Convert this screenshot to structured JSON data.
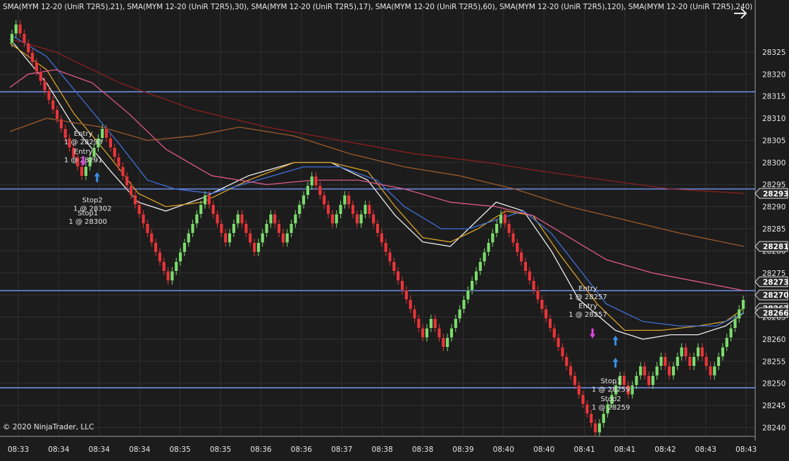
{
  "header": {
    "indicator_title": "SMA(MYM 12-20 (UniR T2R5),21), SMA(MYM 12-20 (UniR T2R5),30), SMA(MYM 12-20 (UniR T2R5),17), SMA(MYM 12-20 (UniR T2R5),60), SMA(MYM 12-20 (UniR T2R5),120), SMA(MYM 12-20 (UniR T2R5),240)"
  },
  "footer": {
    "copyright": "© 2020 NinjaTrader, LLC"
  },
  "icons": {
    "nav": "arrow-right-icon"
  },
  "colors": {
    "background": "#1c1c1c",
    "grid": "#2f2f2f",
    "up_bar": "#7ddc6e",
    "down_bar": "#e8363a",
    "hline": "#6f8fe6",
    "sma_white": "#ececec",
    "sma_gold": "#d9a12a",
    "sma_blue": "#3f6fd9",
    "sma_pink": "#e0598a",
    "sma_brown": "#9c5a2c",
    "sma_darkred": "#8c1f1f"
  },
  "chart_data": {
    "type": "candlestick",
    "title": "",
    "instrument": "MYM 12-20",
    "bar_type": "UniR T2R5",
    "ylim": [
      28238,
      28332
    ],
    "y_ticks": [
      28325,
      28320,
      28315,
      28310,
      28305,
      28300,
      28295,
      28290,
      28285,
      28280,
      28275,
      28270,
      28265,
      28260,
      28255,
      28250,
      28245,
      28240
    ],
    "x_ticks": [
      "08:33",
      "08:34",
      "08:34",
      "08:34",
      "08:35",
      "08:35",
      "08:36",
      "08:36",
      "08:37",
      "08:38",
      "08:38",
      "08:39",
      "08:40",
      "08:40",
      "08:41",
      "08:41",
      "08:42",
      "08:43",
      "08:43"
    ],
    "grid": true,
    "horizontal_lines": [
      28316,
      28294,
      28271,
      28249
    ],
    "price_markers": [
      {
        "value": 28293,
        "label": "28293"
      },
      {
        "value": 28281,
        "label": "28281"
      },
      {
        "value": 28273,
        "label": "28273"
      },
      {
        "value": 28270,
        "label": "28270"
      },
      {
        "value": 28267,
        "label": "28267"
      },
      {
        "value": 28266,
        "label": "28266"
      }
    ],
    "renko_moves": [
      {
        "dir": 1,
        "n": 2
      },
      {
        "dir": -1,
        "n": 16
      },
      {
        "dir": 1,
        "n": 5
      },
      {
        "dir": -1,
        "n": 16
      },
      {
        "dir": 1,
        "n": 9
      },
      {
        "dir": -1,
        "n": 5
      },
      {
        "dir": 1,
        "n": 3
      },
      {
        "dir": -1,
        "n": 4
      },
      {
        "dir": 1,
        "n": 4
      },
      {
        "dir": -1,
        "n": 3
      },
      {
        "dir": 1,
        "n": 7
      },
      {
        "dir": -1,
        "n": 5
      },
      {
        "dir": 1,
        "n": 3
      },
      {
        "dir": -1,
        "n": 3
      },
      {
        "dir": 1,
        "n": 2
      },
      {
        "dir": -1,
        "n": 14
      },
      {
        "dir": 1,
        "n": 2
      },
      {
        "dir": -1,
        "n": 3
      },
      {
        "dir": 1,
        "n": 14
      },
      {
        "dir": -1,
        "n": 23
      },
      {
        "dir": 1,
        "n": 6
      },
      {
        "dir": -1,
        "n": 2
      },
      {
        "dir": 1,
        "n": 3
      },
      {
        "dir": -1,
        "n": 2
      },
      {
        "dir": 1,
        "n": 3
      },
      {
        "dir": -1,
        "n": 2
      },
      {
        "dir": 1,
        "n": 3
      },
      {
        "dir": -1,
        "n": 2
      },
      {
        "dir": 1,
        "n": 2
      },
      {
        "dir": -1,
        "n": 3
      },
      {
        "dir": 1,
        "n": 8
      }
    ],
    "series": [
      {
        "name": "SMA 17",
        "color": "#ececec",
        "values": [
          [
            0,
            28328
          ],
          [
            8,
            28318
          ],
          [
            14,
            28308
          ],
          [
            22,
            28298
          ],
          [
            28,
            28291
          ],
          [
            34,
            28289
          ],
          [
            42,
            28292
          ],
          [
            52,
            28297
          ],
          [
            62,
            28300
          ],
          [
            70,
            28300
          ],
          [
            78,
            28296
          ],
          [
            84,
            28288
          ],
          [
            90,
            28282
          ],
          [
            96,
            28281
          ],
          [
            102,
            28287
          ],
          [
            106,
            28291
          ],
          [
            112,
            28289
          ],
          [
            118,
            28280
          ],
          [
            124,
            28269
          ],
          [
            132,
            28262
          ],
          [
            138,
            28260
          ],
          [
            144,
            28261
          ],
          [
            150,
            28261
          ],
          [
            156,
            28263
          ],
          [
            160,
            28266
          ]
        ]
      },
      {
        "name": "SMA 21",
        "color": "#d9a12a",
        "values": [
          [
            0,
            28327
          ],
          [
            8,
            28321
          ],
          [
            14,
            28311
          ],
          [
            22,
            28301
          ],
          [
            28,
            28293
          ],
          [
            34,
            28290
          ],
          [
            42,
            28291
          ],
          [
            52,
            28296
          ],
          [
            62,
            28300
          ],
          [
            70,
            28300
          ],
          [
            78,
            28298
          ],
          [
            84,
            28290
          ],
          [
            90,
            28283
          ],
          [
            96,
            28282
          ],
          [
            102,
            28285
          ],
          [
            108,
            28289
          ],
          [
            114,
            28288
          ],
          [
            120,
            28279
          ],
          [
            128,
            28268
          ],
          [
            134,
            28262
          ],
          [
            142,
            28262
          ],
          [
            150,
            28263
          ],
          [
            156,
            28264
          ],
          [
            160,
            28267
          ]
        ]
      },
      {
        "name": "SMA 30",
        "color": "#3f6fd9",
        "values": [
          [
            0,
            28329
          ],
          [
            8,
            28324
          ],
          [
            16,
            28314
          ],
          [
            24,
            28304
          ],
          [
            30,
            28296
          ],
          [
            36,
            28294
          ],
          [
            44,
            28293
          ],
          [
            54,
            28296
          ],
          [
            64,
            28299
          ],
          [
            72,
            28299
          ],
          [
            80,
            28296
          ],
          [
            86,
            28290
          ],
          [
            94,
            28285
          ],
          [
            100,
            28285
          ],
          [
            106,
            28287
          ],
          [
            112,
            28289
          ],
          [
            118,
            28284
          ],
          [
            124,
            28276
          ],
          [
            130,
            28268
          ],
          [
            138,
            28264
          ],
          [
            146,
            28263
          ],
          [
            154,
            28263
          ],
          [
            160,
            28266
          ]
        ]
      },
      {
        "name": "SMA 60",
        "color": "#e0598a",
        "values": [
          [
            0,
            28317
          ],
          [
            4,
            28320
          ],
          [
            10,
            28321
          ],
          [
            18,
            28318
          ],
          [
            26,
            28311
          ],
          [
            34,
            28303
          ],
          [
            44,
            28297
          ],
          [
            56,
            28295
          ],
          [
            66,
            28296
          ],
          [
            76,
            28296
          ],
          [
            86,
            28294
          ],
          [
            96,
            28291
          ],
          [
            106,
            28290
          ],
          [
            114,
            28288
          ],
          [
            122,
            28283
          ],
          [
            130,
            28278
          ],
          [
            140,
            28275
          ],
          [
            150,
            28273
          ],
          [
            160,
            28271
          ]
        ]
      },
      {
        "name": "SMA 120",
        "color": "#9c5a2c",
        "values": [
          [
            0,
            28307
          ],
          [
            8,
            28310
          ],
          [
            20,
            28308
          ],
          [
            30,
            28305
          ],
          [
            40,
            28306
          ],
          [
            50,
            28308
          ],
          [
            62,
            28306
          ],
          [
            74,
            28302
          ],
          [
            86,
            28299
          ],
          [
            98,
            28297
          ],
          [
            110,
            28294
          ],
          [
            122,
            28290
          ],
          [
            134,
            28287
          ],
          [
            146,
            28284
          ],
          [
            160,
            28281
          ]
        ]
      },
      {
        "name": "SMA 240",
        "color": "#8c1f1f",
        "values": [
          [
            0,
            28328
          ],
          [
            10,
            28325
          ],
          [
            24,
            28318
          ],
          [
            40,
            28312
          ],
          [
            56,
            28308
          ],
          [
            72,
            28305
          ],
          [
            88,
            28302
          ],
          [
            104,
            28300
          ],
          [
            116,
            28298
          ],
          [
            130,
            28296
          ],
          [
            144,
            28294
          ],
          [
            160,
            28293
          ]
        ]
      }
    ],
    "annotations": [
      {
        "lines": [
          "Entry",
          "1 @ 28293"
        ],
        "x": 16,
        "y": 28306
      },
      {
        "lines": [
          "Entry",
          "1 @ 28291"
        ],
        "x": 16,
        "y": 28302
      },
      {
        "lines": [
          "Stop2",
          "1 @ 28302"
        ],
        "x": 18,
        "y": 28291
      },
      {
        "lines": [
          "Stop1",
          "1 @ 28300"
        ],
        "x": 17,
        "y": 28288
      },
      {
        "lines": [
          "Entry",
          "1 @ 28257"
        ],
        "x": 126,
        "y": 28271
      },
      {
        "lines": [
          "Entry",
          "1 @ 28257"
        ],
        "x": 126,
        "y": 28267
      },
      {
        "lines": [
          "Stop1",
          "1 @ 28259"
        ],
        "x": 131,
        "y": 28250
      },
      {
        "lines": [
          "Stop2",
          "1 @ 28259"
        ],
        "x": 131,
        "y": 28246
      }
    ],
    "markers": [
      {
        "type": "sell",
        "x": 16,
        "y": 28300
      },
      {
        "type": "buy",
        "x": 19,
        "y": 28297
      },
      {
        "type": "sell",
        "x": 127,
        "y": 28261
      },
      {
        "type": "buy",
        "x": 132,
        "y": 28255
      },
      {
        "type": "buy",
        "x": 132,
        "y": 28260
      }
    ]
  }
}
